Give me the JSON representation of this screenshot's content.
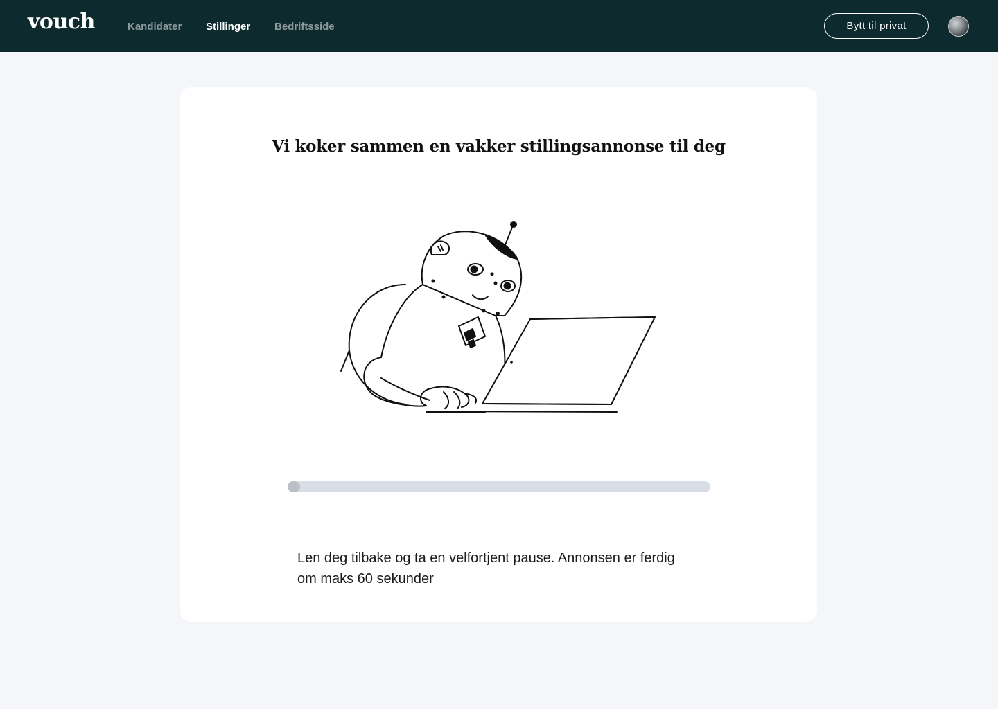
{
  "header": {
    "logo": "vouch",
    "nav": [
      {
        "label": "Kandidater",
        "active": false
      },
      {
        "label": "Stillinger",
        "active": true
      },
      {
        "label": "Bedriftsside",
        "active": false
      }
    ],
    "switch_button": "Bytt til privat",
    "colors": {
      "background": "#0d2a2f",
      "active_text": "#ffffff",
      "inactive_text": "#8d9a9c"
    }
  },
  "main": {
    "title": "Vi koker sammen en vakker stillingsannonse til deg",
    "illustration": "robot-typing-on-laptop",
    "progress": {
      "percent": 2
    },
    "message": "Len deg tilbake og ta en velfortjent pause. Annonsen er ferdig om maks 60 sekunder"
  }
}
